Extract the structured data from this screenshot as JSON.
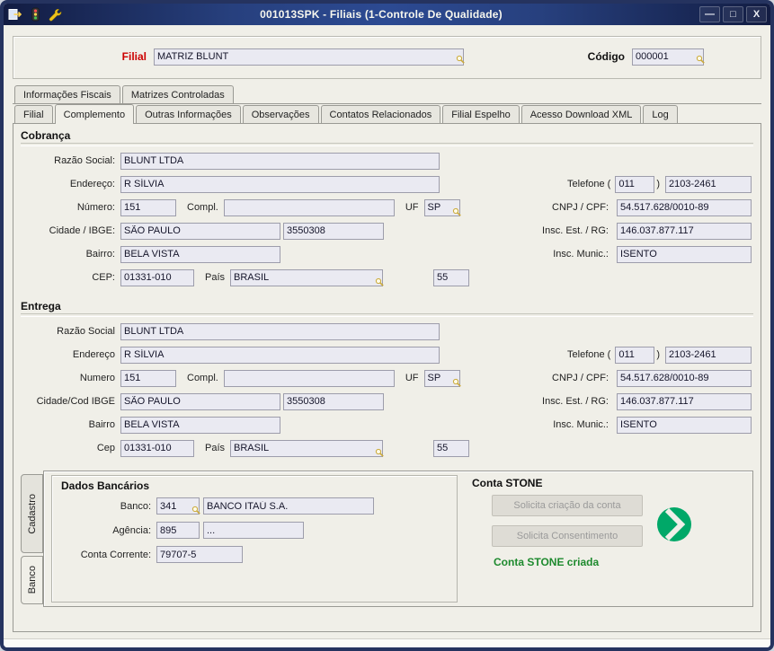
{
  "window": {
    "title": "001013SPK - Filiais (1-Controle De Qualidade)",
    "controls": {
      "minimize": "—",
      "maximize": "□",
      "close": "X"
    }
  },
  "header": {
    "filial_label": "Filial",
    "filial_value": "MATRIZ BLUNT",
    "codigo_label": "Código",
    "codigo_value": "000001"
  },
  "tabs": {
    "row1": [
      "Informações Fiscais",
      "Matrizes Controladas"
    ],
    "row2": [
      "Filial",
      "Complemento",
      "Outras Informações",
      "Observações",
      "Contatos Relacionados",
      "Filial Espelho",
      "Acesso Download XML",
      "Log"
    ],
    "active": "Complemento"
  },
  "cobranca": {
    "title": "Cobrança",
    "labels": {
      "razao": "Razão Social:",
      "endereco": "Endereço:",
      "numero": "Número:",
      "compl": "Compl.",
      "uf": "UF",
      "cidade": "Cidade / IBGE:",
      "bairro": "Bairro:",
      "cep": "CEP:",
      "pais": "País",
      "telefone": "Telefone (",
      "telefone_close": ")",
      "cnpj": "CNPJ / CPF:",
      "insc_est": "Insc. Est. / RG:",
      "insc_mun": "Insc. Munic.:"
    },
    "values": {
      "razao": "BLUNT LTDA",
      "endereco": "R SÍLVIA",
      "numero": "151",
      "compl": "",
      "uf": "SP",
      "cidade": "SÃO PAULO",
      "ibge": "3550308",
      "bairro": "BELA VISTA",
      "cep": "01331-010",
      "pais": "BRASIL",
      "ddi": "55",
      "ddd": "011",
      "fone": "2103-2461",
      "cnpj": "54.517.628/0010-89",
      "insc_est": "146.037.877.117",
      "insc_mun": "ISENTO"
    }
  },
  "entrega": {
    "title": "Entrega",
    "labels": {
      "razao": "Razão Social",
      "endereco": "Endereço",
      "numero": "Numero",
      "compl": "Compl.",
      "uf": "UF",
      "cidade": "Cidade/Cod IBGE",
      "bairro": "Bairro",
      "cep": "Cep",
      "pais": "País",
      "telefone": "Telefone (",
      "telefone_close": ")",
      "cnpj": "CNPJ / CPF:",
      "insc_est": "Insc. Est. / RG:",
      "insc_mun": "Insc. Munic.:"
    },
    "values": {
      "razao": "BLUNT LTDA",
      "endereco": "R SÍLVIA",
      "numero": "151",
      "compl": "",
      "uf": "SP",
      "cidade": "SÃO PAULO",
      "ibge": "3550308",
      "bairro": "BELA VISTA",
      "cep": "01331-010",
      "pais": "BRASIL",
      "ddi": "55",
      "ddd": "011",
      "fone": "2103-2461",
      "cnpj": "54.517.628/0010-89",
      "insc_est": "146.037.877.117",
      "insc_mun": "ISENTO"
    }
  },
  "bottom": {
    "vertical_tabs": [
      "Cadastro",
      "Banco"
    ],
    "active_vertical_tab": "Banco",
    "dados_bancarios": {
      "title": "Dados Bancários",
      "banco_label": "Banco:",
      "banco_code": "341",
      "banco_name": "BANCO ITAÚ S.A.",
      "agencia_label": "Agência:",
      "agencia_value": "895",
      "agencia_desc": "...",
      "conta_label": "Conta Corrente:",
      "conta_value": "79707-5"
    },
    "conta_stone": {
      "title": "Conta STONE",
      "btn_solicita_criacao": "Solicita criação da conta",
      "btn_solicita_consentimento": "Solicita Consentimento",
      "status": "Conta STONE criada"
    }
  },
  "colors": {
    "titlebar_blue": "#27407e",
    "filial_label_red": "#cc0000",
    "stone_green": "#00a868",
    "status_green": "#1e8a2e"
  }
}
